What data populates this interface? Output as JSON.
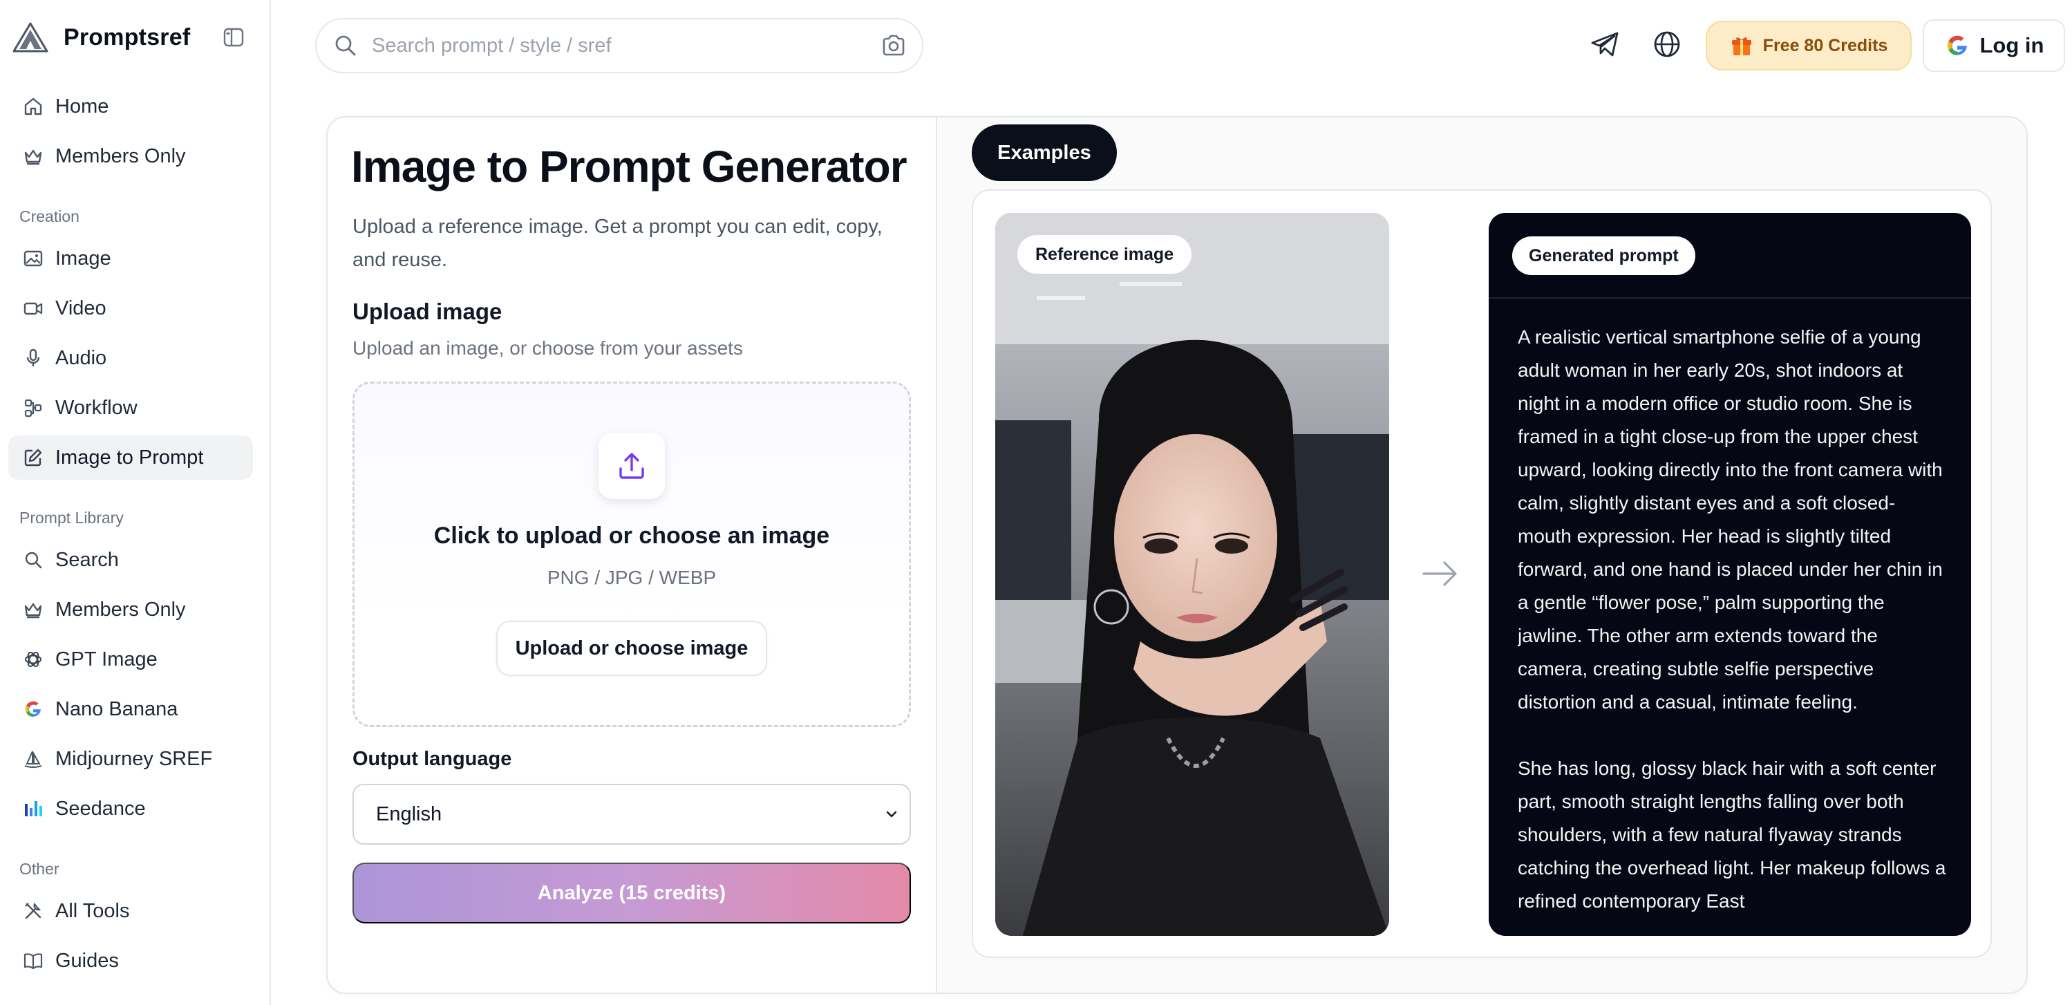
{
  "brand": {
    "name": "Promptsref"
  },
  "sidebar": {
    "top_items": [
      {
        "label": "Home",
        "icon": "home-icon"
      },
      {
        "label": "Members Only",
        "icon": "crown-icon"
      }
    ],
    "sections": [
      {
        "label": "Creation",
        "items": [
          {
            "label": "Image",
            "icon": "image-icon"
          },
          {
            "label": "Video",
            "icon": "video-icon"
          },
          {
            "label": "Audio",
            "icon": "microphone-icon"
          },
          {
            "label": "Workflow",
            "icon": "workflow-icon"
          },
          {
            "label": "Image to Prompt",
            "icon": "pencil-icon",
            "active": true
          }
        ]
      },
      {
        "label": "Prompt Library",
        "items": [
          {
            "label": "Search",
            "icon": "search-icon"
          },
          {
            "label": "Members Only",
            "icon": "crown-icon"
          },
          {
            "label": "GPT Image",
            "icon": "openai-icon"
          },
          {
            "label": "Nano Banana",
            "icon": "google-icon"
          },
          {
            "label": "Midjourney SREF",
            "icon": "sailboat-icon"
          },
          {
            "label": "Seedance",
            "icon": "bars-icon"
          }
        ]
      },
      {
        "label": "Other",
        "items": [
          {
            "label": "All Tools",
            "icon": "tools-icon"
          },
          {
            "label": "Guides",
            "icon": "book-icon"
          }
        ]
      }
    ]
  },
  "header": {
    "search_placeholder": "Search prompt / style / sref",
    "credits_label": "Free 80 Credits",
    "login_label": "Log in"
  },
  "main": {
    "title": "Image to Prompt Generator",
    "subtitle": "Upload a reference image. Get a prompt you can edit, copy, and reuse.",
    "upload_heading": "Upload image",
    "upload_sub": "Upload an image, or choose from your assets",
    "dropzone_title": "Click to upload or choose an image",
    "dropzone_formats": "PNG / JPG / WEBP",
    "dropzone_button": "Upload or choose image",
    "output_language_label": "Output language",
    "output_language_value": "English",
    "analyze_label": "Analyze (15 credits)"
  },
  "examples": {
    "tab_label": "Examples",
    "reference_badge": "Reference image",
    "generated_badge": "Generated prompt",
    "prompt_paragraphs": [
      "A realistic vertical smartphone selfie of a young adult woman in her early 20s, shot indoors at night in a modern office or studio room. She is framed in a tight close-up from the upper chest upward, looking directly into the front camera with calm, slightly distant eyes and a soft closed-mouth expression. Her head is slightly tilted forward, and one hand is placed under her chin in a gentle “flower pose,” palm supporting the jawline. The other arm extends toward the camera, creating subtle selfie perspective distortion and a casual, intimate feeling.",
      "She has long, glossy black hair with a soft center part, smooth straight lengths falling over both shoulders, with a few natural flyaway strands catching the overhead light. Her makeup follows a refined contemporary East"
    ]
  },
  "colors": {
    "accent_dark": "#0b0f1a",
    "credits_bg": "#fdecc8",
    "credits_text": "#8a4b0b",
    "analyze_gradient_start": "#ac95d8",
    "analyze_gradient_end": "#e48aa8",
    "upload_icon": "#7c3aed"
  }
}
